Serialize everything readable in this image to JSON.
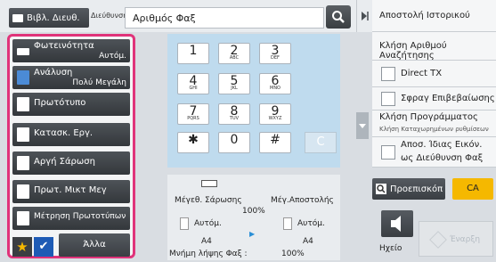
{
  "header": {
    "address_book_label": "Βιβλ. Διευθ.",
    "destination_label": "Διεύθυνση",
    "fax_number_placeholder": "Αριθμός Φαξ"
  },
  "left_menu": [
    {
      "label": "Φωτεινότητα",
      "value": "Αυτόμ."
    },
    {
      "label": "Ανάλυση",
      "value": "Πολύ Μεγάλη"
    },
    {
      "label": "Πρωτότυπο",
      "value": ""
    },
    {
      "label": "Κατασκ. Εργ.",
      "value": ""
    },
    {
      "label": "Αργή Σάρωση",
      "value": ""
    },
    {
      "label": "Πρωτ. Μικτ Μεγ",
      "value": ""
    },
    {
      "label": "Μέτρηση Πρωτοτύπων",
      "value": ""
    }
  ],
  "bottom_left": {
    "other_label": "Άλλα"
  },
  "keypad": {
    "keys": [
      {
        "main": "1",
        "sub": ""
      },
      {
        "main": "2",
        "sub": "ABC"
      },
      {
        "main": "3",
        "sub": "DEF"
      },
      {
        "main": "4",
        "sub": "GHI"
      },
      {
        "main": "5",
        "sub": "JKL"
      },
      {
        "main": "6",
        "sub": "MNO"
      },
      {
        "main": "7",
        "sub": "PQRS"
      },
      {
        "main": "8",
        "sub": "TUV"
      },
      {
        "main": "9",
        "sub": "WXYZ"
      },
      {
        "main": "✱",
        "sub": ""
      },
      {
        "main": "0",
        "sub": ""
      },
      {
        "main": "#",
        "sub": ""
      }
    ],
    "clear_label": "C"
  },
  "info": {
    "scan_size_label": "Μέγεθ. Σάρωσης",
    "send_size_label": "Μέγ.Αποστολής",
    "zoom": "100%",
    "scan_mode": "Αυτόμ.",
    "send_mode": "Αυτόμ.",
    "scan_paper": "A4",
    "send_paper": "A4",
    "memory_label": "Μνήμη λήψης Φαξ :",
    "memory_value": "100%"
  },
  "right_panel": {
    "send_history": "Αποστολή Ιστορικού",
    "call_search_number": "Κλήση Αριθμού Αναζήτησης",
    "direct_tx": "Direct TX",
    "confirmation_stamp": "Σφραγ Επιβεβαίωσης",
    "call_program_title": "Κλήση Προγράμματος",
    "call_program_sub": "Κλήση Καταχωρημένων ρυθμίσεων",
    "send_same_image_line1": "Αποσ. Ίδιας Εικόν.",
    "send_same_image_line2": "ως Διεύθυνση Φαξ"
  },
  "actions": {
    "preview": "Προεπισκόπ",
    "ca": "CA",
    "speaker_label": "Ηχείο",
    "start": "Έναρξη"
  },
  "colors": {
    "highlight_border": "#e0337a",
    "keypad_bg": "#bfdbee",
    "ca_bg": "#f5b800",
    "check_bg": "#1e5bb5"
  }
}
